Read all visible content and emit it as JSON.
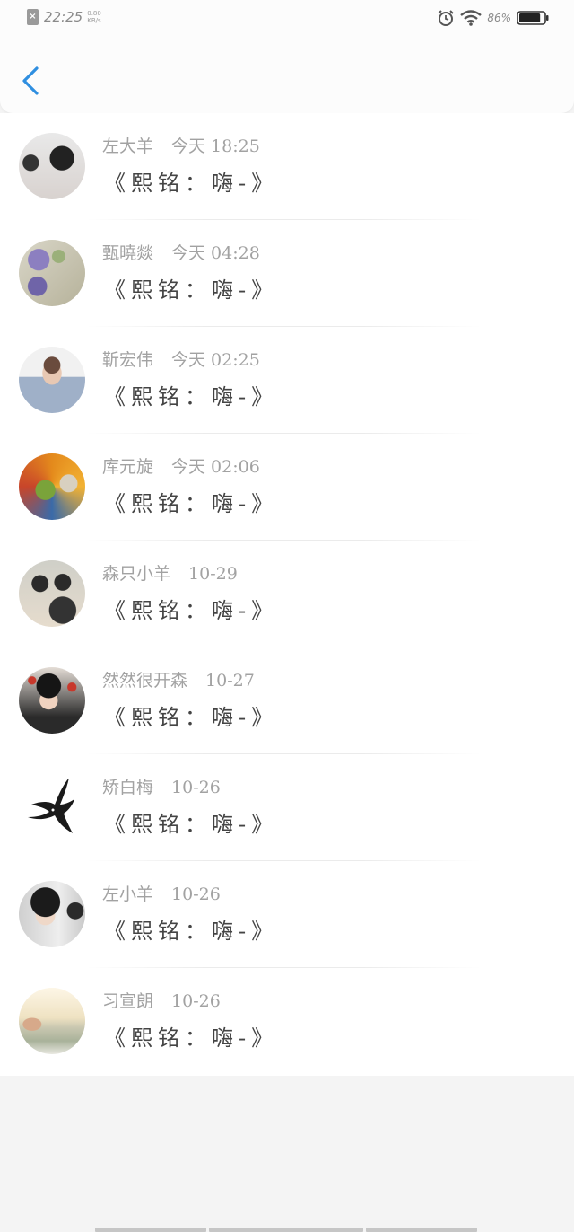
{
  "status_bar": {
    "time": "22:25",
    "net_speed_value": "0.80",
    "net_speed_unit": "KB/s",
    "battery_percent": "86%",
    "battery_level": 0.86
  },
  "nav": {
    "back_icon": "chevron-left-icon",
    "accent_color": "#2f8fe0"
  },
  "messages": [
    {
      "name": "左大羊",
      "time": "今天 18:25",
      "text": "《熙铭：嗨-》"
    },
    {
      "name": "甄曉燚",
      "time": "今天 04:28",
      "text": "《熙铭：嗨-》"
    },
    {
      "name": "靳宏伟",
      "time": "今天 02:25",
      "text": "《熙铭：嗨-》"
    },
    {
      "name": "库元旋",
      "time": "今天 02:06",
      "text": "《熙铭：嗨-》"
    },
    {
      "name": "森只小羊",
      "time": "10-29",
      "text": "《熙铭：嗨-》"
    },
    {
      "name": "然然很开森",
      "time": "10-27",
      "text": "《熙铭：嗨-》"
    },
    {
      "name": "矫白梅",
      "time": "10-26",
      "text": "《熙铭：嗨-》"
    },
    {
      "name": "左小羊",
      "time": "10-26",
      "text": "《熙铭：嗨-》"
    },
    {
      "name": "习宣朗",
      "time": "10-26",
      "text": "《熙铭：嗨-》"
    }
  ]
}
